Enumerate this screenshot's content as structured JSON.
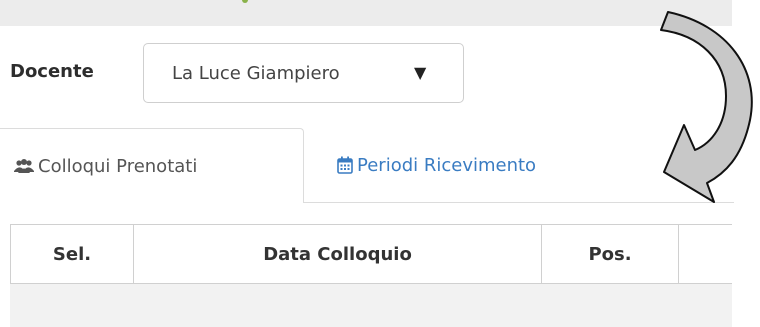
{
  "docente": {
    "label": "Docente",
    "selected": "La Luce Giampiero",
    "dropdown_glyph": "▼"
  },
  "tabs": [
    {
      "label": "Colloqui Prenotati",
      "icon": "users-icon",
      "active": true
    },
    {
      "label": "Periodi Ricevimento",
      "icon": "calendar-icon",
      "active": false
    }
  ],
  "table": {
    "columns": [
      "Sel.",
      "Data Colloquio",
      "Pos.",
      ""
    ]
  },
  "colors": {
    "link": "#3a7cc2",
    "arrow_fill": "#c8c8c8",
    "header_bg": "#ececec"
  }
}
